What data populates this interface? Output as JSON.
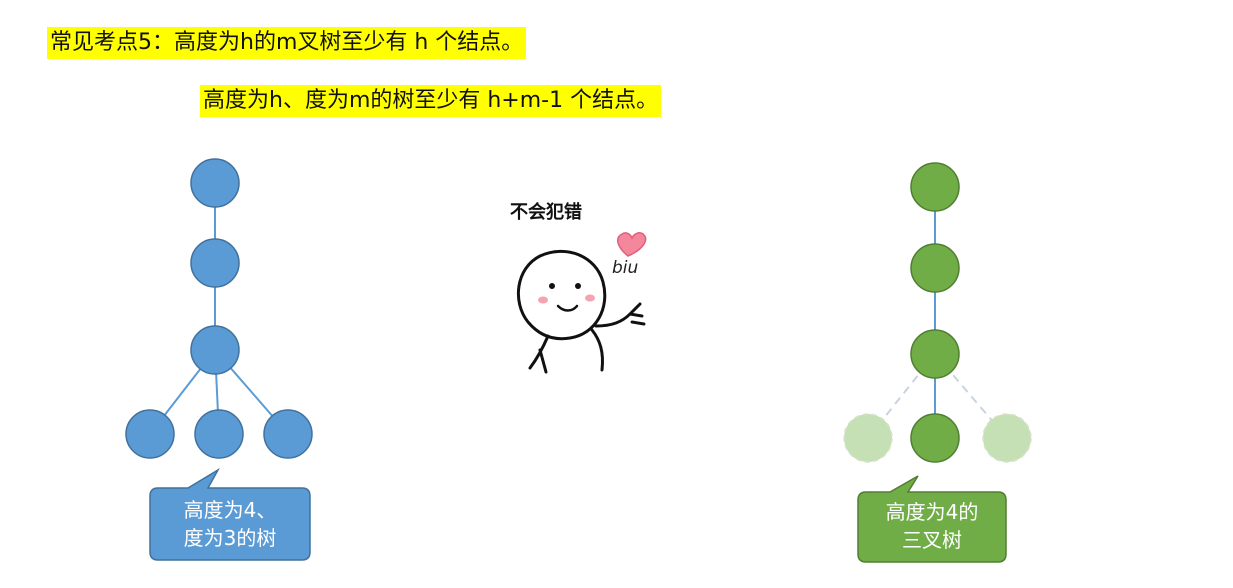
{
  "heading": {
    "line1": "常见考点5：高度为h的m叉树至少有 h 个结点。",
    "line2": "高度为h、度为m的树至少有 h+m-1 个结点。"
  },
  "left_tree": {
    "node_color": "#5b9bd5",
    "node_stroke": "#41719c",
    "callout_color": "#5b9bd5",
    "callout_lines": [
      "高度为4、",
      "度为3的树"
    ]
  },
  "right_tree": {
    "node_color": "#70ad47",
    "node_stroke": "#507e32",
    "faded_node_color": "#c5e0b4",
    "callout_color": "#70ad47",
    "callout_lines": [
      "高度为4的",
      "三叉树"
    ]
  },
  "sticker": {
    "caption": "不会犯错",
    "biu_text": "biu",
    "heart_color": "#f4879b"
  },
  "highlight_color": "#ffff00"
}
